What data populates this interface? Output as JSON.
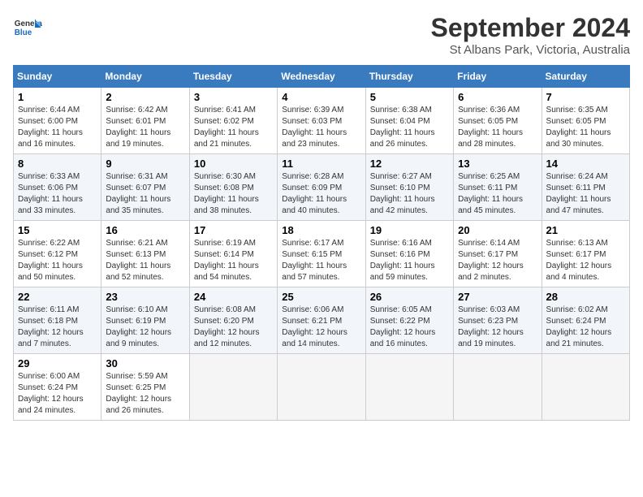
{
  "header": {
    "logo_general": "General",
    "logo_blue": "Blue",
    "title": "September 2024",
    "subtitle": "St Albans Park, Victoria, Australia"
  },
  "columns": [
    "Sunday",
    "Monday",
    "Tuesday",
    "Wednesday",
    "Thursday",
    "Friday",
    "Saturday"
  ],
  "weeks": [
    [
      {
        "day": "1",
        "rise": "6:44 AM",
        "set": "6:00 PM",
        "hours": "11 hours and 16 minutes"
      },
      {
        "day": "2",
        "rise": "6:42 AM",
        "set": "6:01 PM",
        "hours": "11 hours and 19 minutes"
      },
      {
        "day": "3",
        "rise": "6:41 AM",
        "set": "6:02 PM",
        "hours": "11 hours and 21 minutes"
      },
      {
        "day": "4",
        "rise": "6:39 AM",
        "set": "6:03 PM",
        "hours": "11 hours and 23 minutes"
      },
      {
        "day": "5",
        "rise": "6:38 AM",
        "set": "6:04 PM",
        "hours": "11 hours and 26 minutes"
      },
      {
        "day": "6",
        "rise": "6:36 AM",
        "set": "6:05 PM",
        "hours": "11 hours and 28 minutes"
      },
      {
        "day": "7",
        "rise": "6:35 AM",
        "set": "6:05 PM",
        "hours": "11 hours and 30 minutes"
      }
    ],
    [
      {
        "day": "8",
        "rise": "6:33 AM",
        "set": "6:06 PM",
        "hours": "11 hours and 33 minutes"
      },
      {
        "day": "9",
        "rise": "6:31 AM",
        "set": "6:07 PM",
        "hours": "11 hours and 35 minutes"
      },
      {
        "day": "10",
        "rise": "6:30 AM",
        "set": "6:08 PM",
        "hours": "11 hours and 38 minutes"
      },
      {
        "day": "11",
        "rise": "6:28 AM",
        "set": "6:09 PM",
        "hours": "11 hours and 40 minutes"
      },
      {
        "day": "12",
        "rise": "6:27 AM",
        "set": "6:10 PM",
        "hours": "11 hours and 42 minutes"
      },
      {
        "day": "13",
        "rise": "6:25 AM",
        "set": "6:11 PM",
        "hours": "11 hours and 45 minutes"
      },
      {
        "day": "14",
        "rise": "6:24 AM",
        "set": "6:11 PM",
        "hours": "11 hours and 47 minutes"
      }
    ],
    [
      {
        "day": "15",
        "rise": "6:22 AM",
        "set": "6:12 PM",
        "hours": "11 hours and 50 minutes"
      },
      {
        "day": "16",
        "rise": "6:21 AM",
        "set": "6:13 PM",
        "hours": "11 hours and 52 minutes"
      },
      {
        "day": "17",
        "rise": "6:19 AM",
        "set": "6:14 PM",
        "hours": "11 hours and 54 minutes"
      },
      {
        "day": "18",
        "rise": "6:17 AM",
        "set": "6:15 PM",
        "hours": "11 hours and 57 minutes"
      },
      {
        "day": "19",
        "rise": "6:16 AM",
        "set": "6:16 PM",
        "hours": "11 hours and 59 minutes"
      },
      {
        "day": "20",
        "rise": "6:14 AM",
        "set": "6:17 PM",
        "hours": "12 hours and 2 minutes"
      },
      {
        "day": "21",
        "rise": "6:13 AM",
        "set": "6:17 PM",
        "hours": "12 hours and 4 minutes"
      }
    ],
    [
      {
        "day": "22",
        "rise": "6:11 AM",
        "set": "6:18 PM",
        "hours": "12 hours and 7 minutes"
      },
      {
        "day": "23",
        "rise": "6:10 AM",
        "set": "6:19 PM",
        "hours": "12 hours and 9 minutes"
      },
      {
        "day": "24",
        "rise": "6:08 AM",
        "set": "6:20 PM",
        "hours": "12 hours and 12 minutes"
      },
      {
        "day": "25",
        "rise": "6:06 AM",
        "set": "6:21 PM",
        "hours": "12 hours and 14 minutes"
      },
      {
        "day": "26",
        "rise": "6:05 AM",
        "set": "6:22 PM",
        "hours": "12 hours and 16 minutes"
      },
      {
        "day": "27",
        "rise": "6:03 AM",
        "set": "6:23 PM",
        "hours": "12 hours and 19 minutes"
      },
      {
        "day": "28",
        "rise": "6:02 AM",
        "set": "6:24 PM",
        "hours": "12 hours and 21 minutes"
      }
    ],
    [
      {
        "day": "29",
        "rise": "6:00 AM",
        "set": "6:24 PM",
        "hours": "12 hours and 24 minutes"
      },
      {
        "day": "30",
        "rise": "5:59 AM",
        "set": "6:25 PM",
        "hours": "12 hours and 26 minutes"
      },
      {
        "day": "",
        "rise": "",
        "set": "",
        "hours": ""
      },
      {
        "day": "",
        "rise": "",
        "set": "",
        "hours": ""
      },
      {
        "day": "",
        "rise": "",
        "set": "",
        "hours": ""
      },
      {
        "day": "",
        "rise": "",
        "set": "",
        "hours": ""
      },
      {
        "day": "",
        "rise": "",
        "set": "",
        "hours": ""
      }
    ]
  ]
}
